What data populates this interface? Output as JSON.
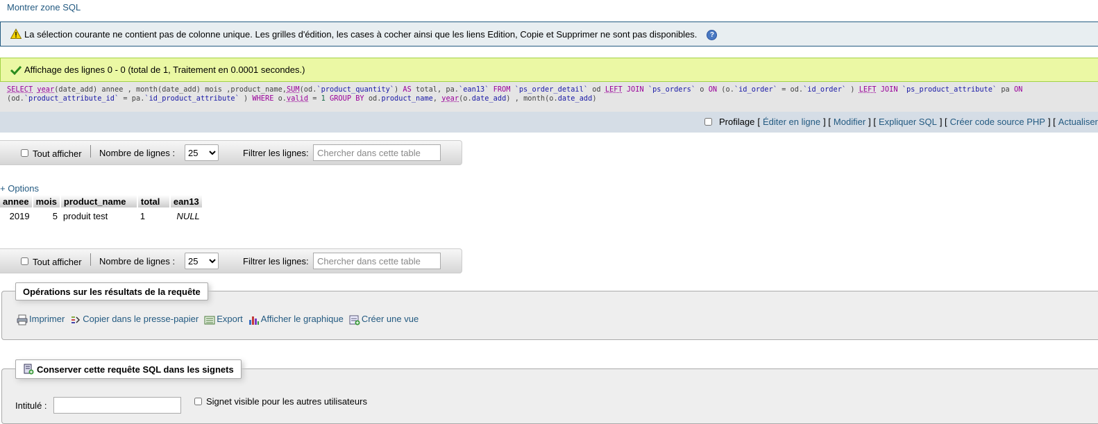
{
  "top_link": "Montrer zone SQL",
  "notice": {
    "text": "La sélection courante ne contient pas de colonne unique. Les grilles d'édition, les cases à cocher ainsi que les liens Edition, Copie et Supprimer ne sont pas disponibles.",
    "help_icon": "?"
  },
  "success": {
    "text": "Affichage des lignes 0 - 0 (total de 1, Traitement en 0.0001 secondes.)"
  },
  "sql": {
    "line1": [
      {
        "t": "SELECT",
        "c": "kw"
      },
      {
        "t": " ",
        "c": ""
      },
      {
        "t": "year",
        "c": "kw"
      },
      {
        "t": "(date_add) annee , month(date_add) mois ,product_name,",
        "c": ""
      },
      {
        "t": "SUM",
        "c": "kw"
      },
      {
        "t": "(od.",
        "c": ""
      },
      {
        "t": "`product_quantity`",
        "c": "str"
      },
      {
        "t": ") ",
        "c": ""
      },
      {
        "t": "AS",
        "c": "kw2"
      },
      {
        "t": " total, pa.",
        "c": ""
      },
      {
        "t": "`ean13`",
        "c": "str"
      },
      {
        "t": " ",
        "c": ""
      },
      {
        "t": "FROM",
        "c": "kw2"
      },
      {
        "t": " ",
        "c": ""
      },
      {
        "t": "`ps_order_detail`",
        "c": "str"
      },
      {
        "t": " od ",
        "c": ""
      },
      {
        "t": "LEFT",
        "c": "kw"
      },
      {
        "t": " ",
        "c": ""
      },
      {
        "t": "JOIN",
        "c": "kw2"
      },
      {
        "t": " ",
        "c": ""
      },
      {
        "t": "`ps_orders`",
        "c": "str"
      },
      {
        "t": " o ",
        "c": ""
      },
      {
        "t": "ON",
        "c": "kw2"
      },
      {
        "t": " (o.",
        "c": ""
      },
      {
        "t": "`id_order`",
        "c": "str"
      },
      {
        "t": " = od.",
        "c": ""
      },
      {
        "t": "`id_order`",
        "c": "str"
      },
      {
        "t": " ) ",
        "c": ""
      },
      {
        "t": "LEFT",
        "c": "kw"
      },
      {
        "t": " ",
        "c": ""
      },
      {
        "t": "JOIN",
        "c": "kw2"
      },
      {
        "t": " ",
        "c": ""
      },
      {
        "t": "`ps_product_attribute`",
        "c": "str"
      },
      {
        "t": " pa ",
        "c": ""
      },
      {
        "t": "ON",
        "c": "kw2"
      }
    ],
    "line2": [
      {
        "t": "(od.",
        "c": ""
      },
      {
        "t": "`product_attribute_id`",
        "c": "str"
      },
      {
        "t": " = pa.",
        "c": ""
      },
      {
        "t": "`id_product_attribute`",
        "c": "str"
      },
      {
        "t": " ) ",
        "c": ""
      },
      {
        "t": "WHERE",
        "c": "kw2"
      },
      {
        "t": " o.",
        "c": ""
      },
      {
        "t": "valid",
        "c": "kw"
      },
      {
        "t": " = ",
        "c": ""
      },
      {
        "t": "1",
        "c": "num"
      },
      {
        "t": " ",
        "c": ""
      },
      {
        "t": "GROUP BY",
        "c": "kw2"
      },
      {
        "t": " od.",
        "c": ""
      },
      {
        "t": "product_name",
        "c": "str"
      },
      {
        "t": ", ",
        "c": ""
      },
      {
        "t": "year",
        "c": "kw"
      },
      {
        "t": "(o.",
        "c": ""
      },
      {
        "t": "date_add",
        "c": "str"
      },
      {
        "t": ") , month(o.",
        "c": ""
      },
      {
        "t": "date_add",
        "c": "str"
      },
      {
        "t": ")",
        "c": ""
      }
    ]
  },
  "tools": {
    "profiling_label": "Profilage",
    "links": [
      "Éditer en ligne",
      "Modifier",
      "Expliquer SQL",
      "Créer code source PHP",
      "Actualiser"
    ]
  },
  "navbar": {
    "show_all_label": "Tout afficher",
    "rows_label": "Nombre de lignes :",
    "rows_value": "25",
    "filter_label": "Filtrer les lignes:",
    "filter_placeholder": "Chercher dans cette table"
  },
  "options_link": "+ Options",
  "table": {
    "columns": [
      "annee",
      "mois",
      "product_name",
      "total",
      "ean13"
    ],
    "rows": [
      [
        "2019",
        "5",
        "produit test",
        "1",
        "NULL"
      ]
    ]
  },
  "operations": {
    "legend": "Opérations sur les résultats de la requête",
    "items": [
      {
        "label": "Imprimer",
        "icon": "print-icon"
      },
      {
        "label": "Copier dans le presse-papier",
        "icon": "clipboard-icon"
      },
      {
        "label": "Export",
        "icon": "export-icon"
      },
      {
        "label": "Afficher le graphique",
        "icon": "chart-icon"
      },
      {
        "label": "Créer une vue",
        "icon": "view-icon"
      }
    ]
  },
  "bookmark": {
    "legend": "Conserver cette requête SQL dans les signets",
    "label_field": "Intitulé :",
    "visible_label": "Signet visible pour les autres utilisateurs"
  }
}
